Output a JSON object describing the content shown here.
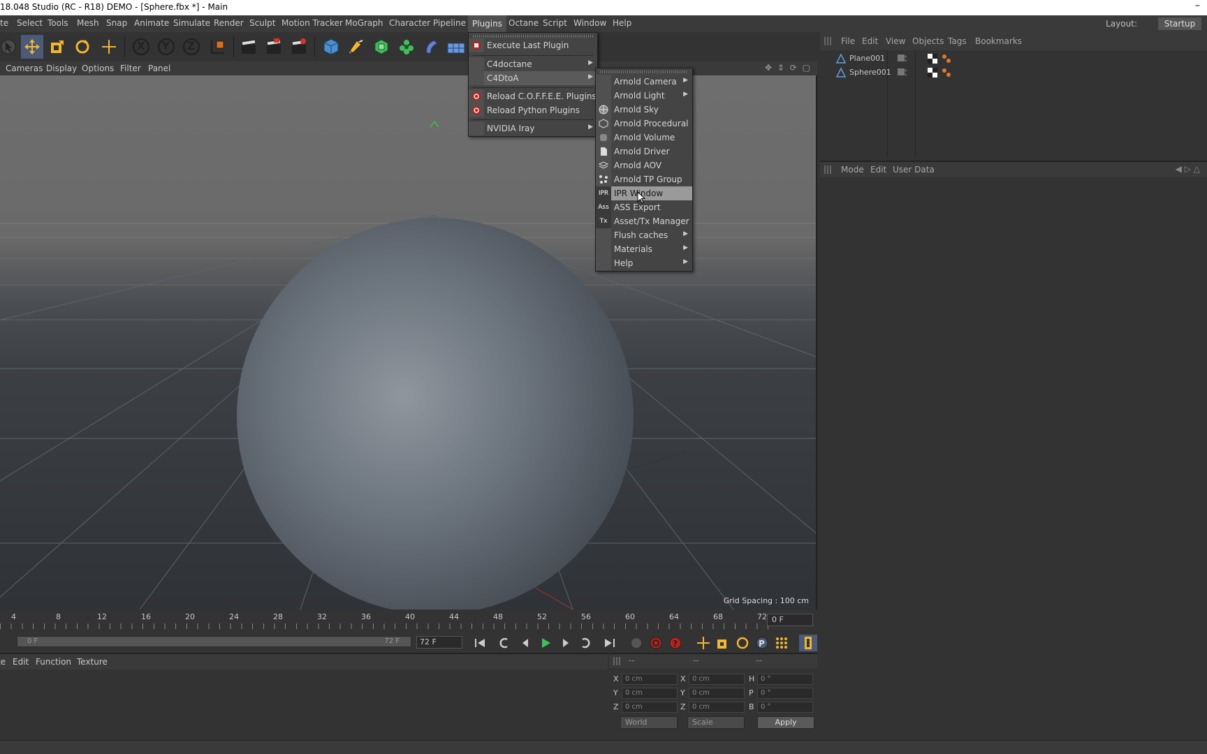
{
  "window": {
    "title": "18.048 Studio (RC - R18) DEMO - [Sphere.fbx *] - Main",
    "minimize_glyph": "–"
  },
  "menubar": {
    "items": [
      "te",
      "Select",
      "Tools",
      "Mesh",
      "Snap",
      "Animate",
      "Simulate",
      "Render",
      "Sculpt",
      "Motion Tracker",
      "MoGraph",
      "Character",
      "Pipeline",
      "Plugins",
      "Octane",
      "Script",
      "Window",
      "Help"
    ],
    "active": "Plugins",
    "layout_label": "Layout:",
    "layout_value": "Startup"
  },
  "toolbar": {
    "axis_x": "X",
    "axis_y": "Y",
    "axis_z": "Z"
  },
  "viewport": {
    "menu": [
      "Cameras",
      "Display",
      "Options",
      "Filter",
      "Panel"
    ],
    "grid_spacing": "Grid Spacing : 100 cm"
  },
  "plugins_menu": {
    "items": [
      {
        "label": "Execute Last Plugin",
        "icon": "plugin-icon"
      },
      {
        "label": "C4doctane",
        "submenu": true
      },
      {
        "label": "C4DtoA",
        "submenu": true,
        "active": true
      },
      {
        "label": "Reload C.O.F.F.E.E. Plugins",
        "icon": "reload-icon"
      },
      {
        "label": "Reload Python Plugins",
        "icon": "reload-icon"
      },
      {
        "label": "NVIDIA Iray",
        "submenu": true
      }
    ]
  },
  "c4dtoa_menu": {
    "items": [
      {
        "label": "Arnold Camera",
        "submenu": true
      },
      {
        "label": "Arnold Light",
        "submenu": true
      },
      {
        "label": "Arnold Sky",
        "icon": "sky-icon"
      },
      {
        "label": "Arnold Procedural",
        "icon": "procedural-icon"
      },
      {
        "label": "Arnold Volume",
        "icon": "volume-icon"
      },
      {
        "label": "Arnold Driver",
        "icon": "driver-icon"
      },
      {
        "label": "Arnold AOV",
        "icon": "aov-icon"
      },
      {
        "label": "Arnold TP Group",
        "icon": "tp-group-icon"
      },
      {
        "label": "IPR Window",
        "icon_text": "IPR",
        "hover": true
      },
      {
        "label": "ASS Export",
        "icon_text": "Ass"
      },
      {
        "label": "Asset/Tx Manager",
        "icon_text": "Tx"
      },
      {
        "label": "Flush caches",
        "submenu": true
      },
      {
        "label": "Materials",
        "submenu": true
      },
      {
        "label": "Help",
        "submenu": true
      }
    ]
  },
  "object_manager": {
    "menu": [
      "File",
      "Edit",
      "View",
      "Objects",
      "Tags",
      "Bookmarks"
    ],
    "objects": [
      {
        "name": "Plane001"
      },
      {
        "name": "Sphere001"
      }
    ]
  },
  "attribute_manager": {
    "menu": [
      "Mode",
      "Edit",
      "User Data"
    ]
  },
  "timeline": {
    "ticks": [
      "4",
      "8",
      "12",
      "16",
      "20",
      "24",
      "28",
      "32",
      "36",
      "40",
      "44",
      "48",
      "52",
      "56",
      "60",
      "64",
      "68",
      "72"
    ],
    "current_frame": "0 F",
    "range_start": "0 F",
    "range_end": "72 F",
    "end_frame": "72 F"
  },
  "material_manager": {
    "menu": [
      "te",
      "Edit",
      "Function",
      "Texture"
    ]
  },
  "coordinates": {
    "headers": [
      "--",
      "--",
      "--"
    ],
    "rows": [
      {
        "l1": "X",
        "v1": "0 cm",
        "l2": "X",
        "v2": "0 cm",
        "l3": "H",
        "v3": "0 °"
      },
      {
        "l1": "Y",
        "v1": "0 cm",
        "l2": "Y",
        "v2": "0 cm",
        "l3": "P",
        "v3": "0 °"
      },
      {
        "l1": "Z",
        "v1": "0 cm",
        "l2": "Z",
        "v2": "0 cm",
        "l3": "B",
        "v3": "0 °"
      }
    ],
    "space_select": "World",
    "mode_select": "Scale",
    "apply_label": "Apply"
  }
}
